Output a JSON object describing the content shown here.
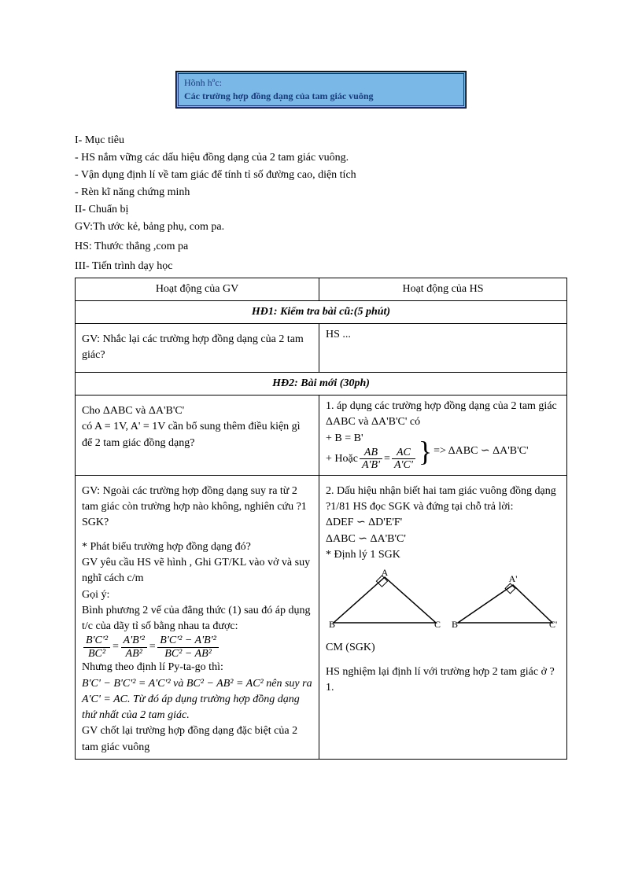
{
  "titleBox": {
    "line1": "Hõnh hºc:",
    "line2": "Các trường hợp đồng dạng của tam giác vuông"
  },
  "intro": {
    "l1": "I- Mục tiêu",
    "l2": "- HS nắm vững các dấu hiệu đồng dạng của 2 tam giác vuông.",
    "l3": "- Vận dụng định lí về tam giác để tính tỉ số đường cao, diện tích",
    "l4": "- Rèn kĩ năng chứng minh",
    "l5": "II- Chuẩn bị",
    "l6": "GV:Th   ước kẻ, bảng phụ, com pa.",
    "l7": "HS: Thước thẳng ,com pa",
    "l8": "III- Tiến trình dạy học"
  },
  "tbl": {
    "hdr_gv": "Hoạt động của GV",
    "hdr_hs": "Hoạt động của HS",
    "hd1_title": "HĐ1: Kiểm tra bài cũ:(5 phút)",
    "hd1_gv": "GV: Nhắc lại các trường hợp đồng dạng của 2 tam giác?",
    "hd1_hs": "HS ...",
    "hd2_title": "HĐ2: Bài mới  (30ph)",
    "r1_gv": {
      "l1": "Cho ΔABC và ΔA'B'C'",
      "l2": "có A = 1V, A' = 1V cần bổ sung thêm điều kiện gì để 2 tam giác đồng dạng?"
    },
    "r1_hs": {
      "l1": "1. áp dụng các trường hợp đồng dạng của 2 tam giác",
      "l2": "ΔABC và ΔA'B'C' có",
      "l3a": "+ B = B'",
      "l3b_prefix": "+ Hoặc ",
      "frac1_num": "AB",
      "frac1_den": "A'B'",
      "frac2_num": "AC",
      "frac2_den": "A'C'",
      "conclusion": " => ΔABC ∽ ΔA'B'C'"
    },
    "r2_gv": {
      "l1": "GV: Ngoài  các trường hợp đồng dạng suy ra từ 2 tam giác còn trường hợp nào không, nghiên cứu ?1 SGK?",
      "l2": "* Phát biểu trường hợp đồng dạng đó?",
      "l3": "GV yêu cầu HS vẽ hình , Ghi GT/KL vào vở và suy nghĩ cách c/m",
      "l4": "Gọi ý:",
      "l5": "Bình phương 2 vế của đẳng thức (1) sau đó áp dụng t/c của dãy tỉ số bằng nhau ta được:",
      "eq1_f1n": "B'C'²",
      "eq1_f1d": "BC²",
      "eq1_f2n": "A'B'²",
      "eq1_f2d": "AB²",
      "eq1_f3n": "B'C'² − A'B'²",
      "eq1_f3d": "BC² − AB²",
      "l6": "Nhưng theo định lí Py-ta-go thì:",
      "l7": "B'C' − B'C'² = A'C'²  và  BC² − AB² = AC²  nên suy ra A'C' = AC. Từ đó áp dụng trường hợp đồng dạng thứ nhất của 2 tam giác.",
      "l8": "GV chốt lại trường hợp đồng dạng đặc biệt của 2 tam giác vuông"
    },
    "r2_hs": {
      "l1": "2. Dấu hiệu nhận biết hai tam giác  vuông đồng dạng",
      "l2": "?1/81 HS đọc SGK và đứng tại chỗ trả lời:",
      "l3": "ΔDEF ∽ ΔD'E'F'",
      "l4": "ΔABC ∽ ΔA'B'C'",
      "l5": "* Định lý 1 SGK",
      "tri1_A": "A",
      "tri1_B": "B",
      "tri1_C": "C",
      "tri2_A": "A'",
      "tri2_B": "B'",
      "tri2_C": "C'",
      "l6": "CM (SGK)",
      "l7": "HS nghiệm lại định lí với trường hợp 2 tam giác ở ?1."
    }
  }
}
